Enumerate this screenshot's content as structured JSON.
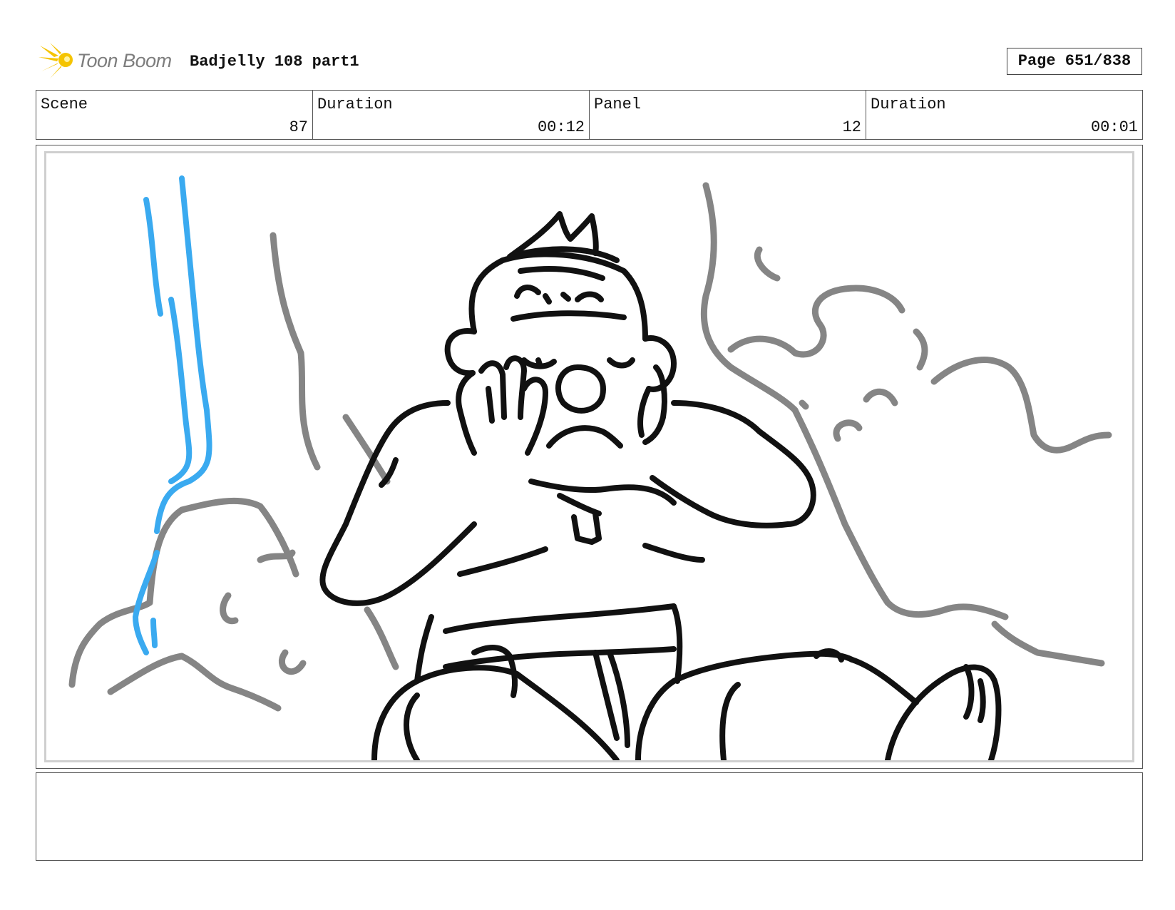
{
  "header": {
    "logo_text": "Toon Boom",
    "title": "Badjelly 108 part1",
    "page_label": "Page 651/838"
  },
  "info": {
    "scene_label": "Scene",
    "scene_value": "87",
    "scene_duration_label": "Duration",
    "scene_duration_value": "00:12",
    "panel_label": "Panel",
    "panel_value": "12",
    "panel_duration_label": "Duration",
    "panel_duration_value": "00:01"
  },
  "notes": {
    "text": ""
  },
  "colors": {
    "sketch_black": "#111111",
    "sketch_gray": "#858585",
    "water_blue": "#3aaaf0",
    "logo_yellow": "#f5c400"
  }
}
